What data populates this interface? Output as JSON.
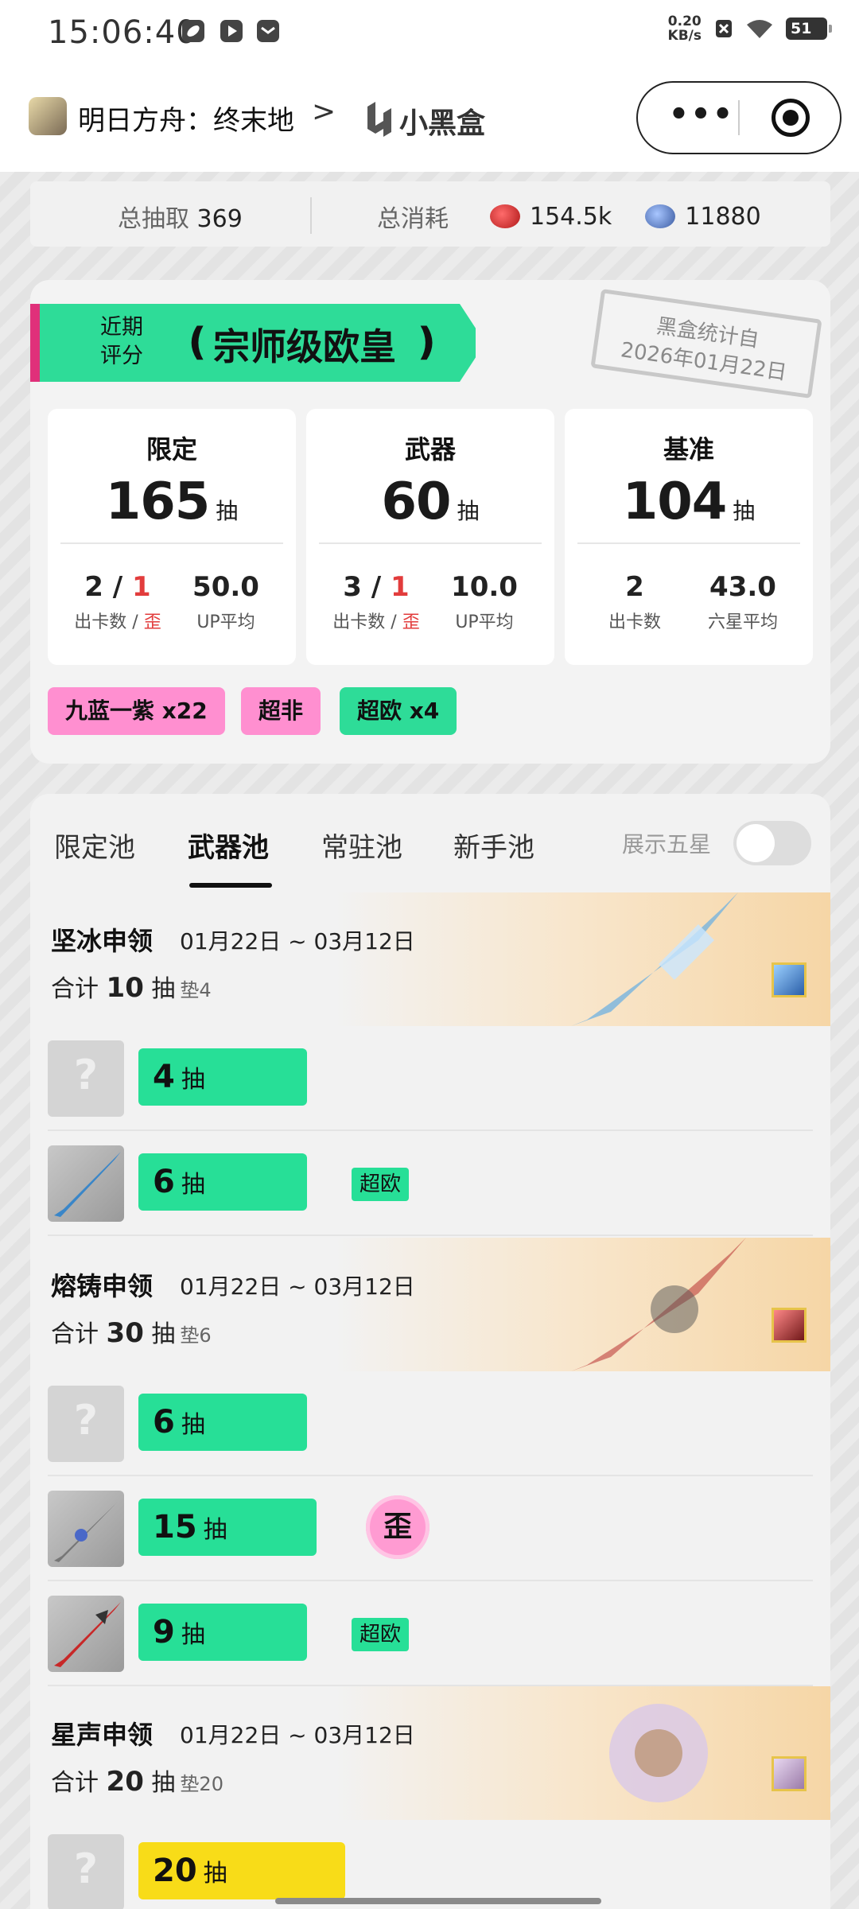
{
  "status": {
    "time": "15:06:40",
    "net_speed_value": "0.20",
    "net_speed_unit": "KB/s",
    "battery": "51"
  },
  "nav": {
    "app_title": "明日方舟：终末地",
    "chevron": ">",
    "brand": "小黑盒",
    "more": "•••"
  },
  "totals": {
    "pulls_label": "总抽取",
    "pulls_value": "369",
    "cost_label": "总消耗",
    "cost1": "154.5k",
    "cost2": "11880"
  },
  "score": {
    "sub_label_1": "近期",
    "sub_label_2": "评分",
    "rank": "宗师级欧皇",
    "laurel_left": "❪",
    "laurel_right": "❫",
    "stamp_line1": "黑盒统计自",
    "stamp_line2": "2026年01月22日"
  },
  "stats": [
    {
      "title": "限定",
      "count": "165",
      "unit": "抽",
      "c1_a": "2",
      "c1_sep": " / ",
      "c1_b": "1",
      "c1_label": "出卡数 / ",
      "c1_label_red": "歪",
      "c2_val": "50.0",
      "c2_label": "UP平均"
    },
    {
      "title": "武器",
      "count": "60",
      "unit": "抽",
      "c1_a": "3",
      "c1_sep": " / ",
      "c1_b": "1",
      "c1_label": "出卡数 / ",
      "c1_label_red": "歪",
      "c2_val": "10.0",
      "c2_label": "UP平均"
    },
    {
      "title": "基准",
      "count": "104",
      "unit": "抽",
      "c1_a": "2",
      "c1_sep": "",
      "c1_b": "",
      "c1_label": "出卡数",
      "c1_label_red": "",
      "c2_val": "43.0",
      "c2_label": "六星平均"
    }
  ],
  "tags": [
    "九蓝一紫 x22",
    "超非",
    "超欧 x4"
  ],
  "tag_colors": {
    "pink": "#ff8fd0",
    "green": "#2edc98"
  },
  "tabs": [
    "限定池",
    "武器池",
    "常驻池",
    "新手池"
  ],
  "active_tab": "武器池",
  "toggle_label": "展示五星",
  "pools": [
    {
      "name": "坚冰申领",
      "date": "01月22日 ~ 03月12日",
      "total_prefix": "合计",
      "total": "10",
      "unit": "抽",
      "pad": "垫4",
      "rows": [
        {
          "count": "4",
          "unit": "抽",
          "badge": ""
        },
        {
          "count": "6",
          "unit": "抽",
          "badge": "超欧"
        }
      ]
    },
    {
      "name": "熔铸申领",
      "date": "01月22日 ~ 03月12日",
      "total_prefix": "合计",
      "total": "30",
      "unit": "抽",
      "pad": "垫6",
      "rows": [
        {
          "count": "6",
          "unit": "抽",
          "badge": ""
        },
        {
          "count": "15",
          "unit": "抽",
          "badge": "歪"
        },
        {
          "count": "9",
          "unit": "抽",
          "badge": "超欧"
        }
      ]
    },
    {
      "name": "星声申领",
      "date": "01月22日 ~ 03月12日",
      "total_prefix": "合计",
      "total": "20",
      "unit": "抽",
      "pad": "垫20",
      "rows": [
        {
          "count": "20",
          "unit": "抽",
          "badge": ""
        }
      ]
    }
  ]
}
